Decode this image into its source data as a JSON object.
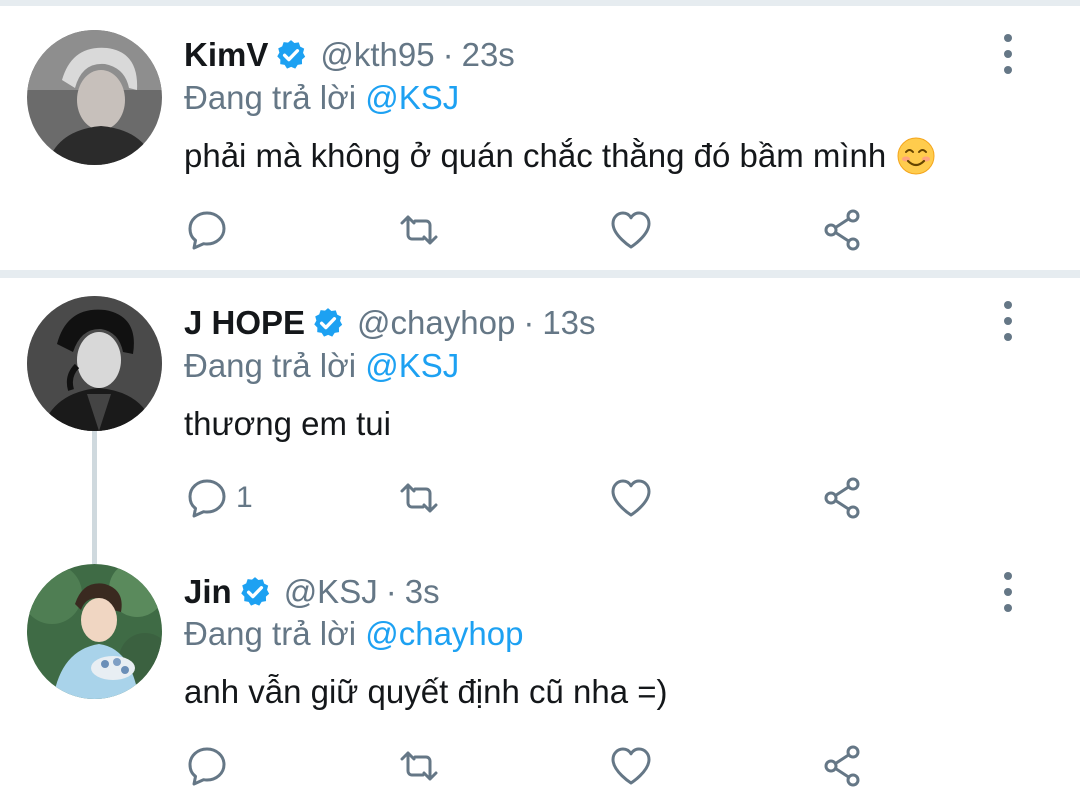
{
  "tweets": [
    {
      "name": "KimV",
      "handle": "@kth95",
      "separator": "·",
      "time": "23s",
      "reply_prefix": "Đang trả lời",
      "reply_to": "@KSJ",
      "text": "phải mà không ở quán chắc thằng đó bầm mình",
      "emoji": "smiling-face-emoji",
      "reply_count": "",
      "avatar": "profile-photo-kimv"
    },
    {
      "name": "J HOPE",
      "handle": "@chayhop",
      "separator": "·",
      "time": "13s",
      "reply_prefix": "Đang trả lời",
      "reply_to": "@KSJ",
      "text": "thương em tui",
      "reply_count": "1",
      "avatar": "profile-photo-jhope"
    },
    {
      "name": "Jin",
      "handle": "@KSJ",
      "separator": "·",
      "time": "3s",
      "reply_prefix": "Đang trả lời",
      "reply_to": "@chayhop",
      "text": "anh vẫn giữ quyết định cũ nha =)",
      "reply_count": "",
      "avatar": "profile-photo-jin"
    }
  ],
  "icons": {
    "verified": "verified-badge-icon",
    "more": "more-vertical-icon",
    "reply": "reply-icon",
    "retweet": "retweet-icon",
    "like": "like-icon",
    "share": "share-icon"
  },
  "colors": {
    "accent": "#1da1f2",
    "text": "#14171a",
    "muted": "#657786",
    "divider": "#e6ecf0"
  }
}
